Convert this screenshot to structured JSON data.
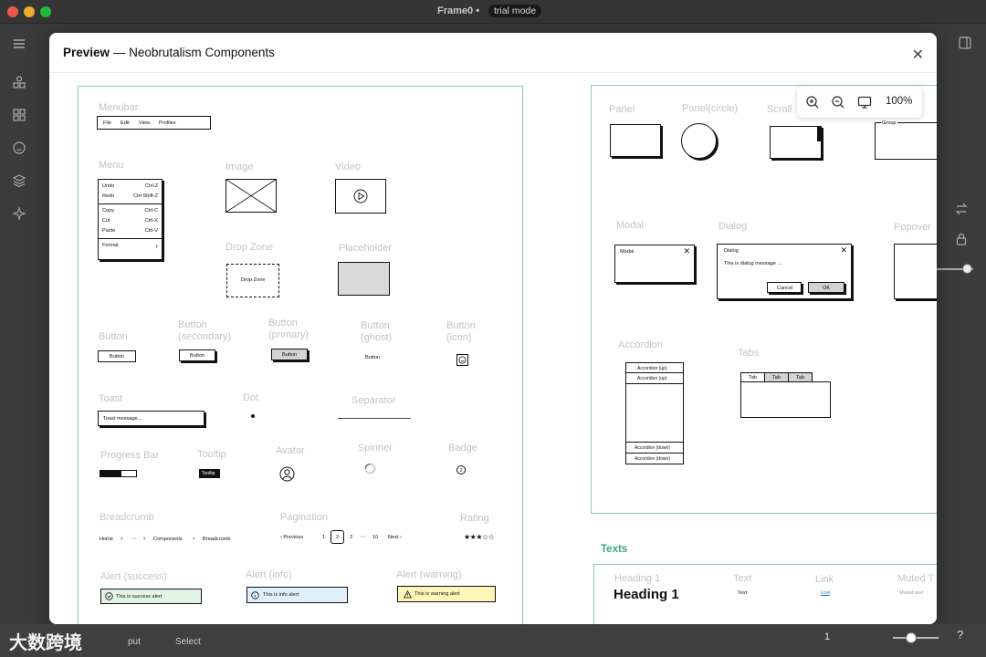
{
  "window": {
    "title": "Frame0 •",
    "badge": "trial mode"
  },
  "modal": {
    "title_bold": "Preview",
    "title_dash": "—",
    "title_rest": "Neobrutalism Components"
  },
  "zoom": {
    "value": "100%"
  },
  "sections": {
    "texts": "Texts"
  },
  "components": {
    "menubar_label": "Menubar",
    "menubar_items": [
      "File",
      "Edit",
      "View",
      "Profiles"
    ],
    "menu_label": "Menu",
    "menu_rows": [
      {
        "label": "Undo",
        "shortcut": "Ctrl-Z"
      },
      {
        "label": "Redo",
        "shortcut": "Ctrl-Shift-Z"
      },
      {
        "label": "Copy",
        "shortcut": "Ctrl-C"
      },
      {
        "label": "Cut",
        "shortcut": "Ctrl-X"
      },
      {
        "label": "Paste",
        "shortcut": "Ctrl-V"
      },
      {
        "label": "Format",
        "shortcut": "›"
      }
    ],
    "image_label": "Image",
    "video_label": "Video",
    "dropzone_label": "Drop Zone",
    "dropzone_text": "Drop Zone",
    "placeholder_label": "Placeholder",
    "button_label": "Button",
    "button_secondary_label": "Button (secondary)",
    "button_primary_label": "Button (primary)",
    "button_ghost_label": "Button (ghost)",
    "button_icon_label": "Button (icon)",
    "button_text": "Button",
    "toast_label": "Toast",
    "toast_text": "Toast message...",
    "dot_label": "Dot",
    "separator_label": "Separator",
    "progress_label": "Progress Bar",
    "progress_value": 0.6,
    "tooltip_label": "Tooltip",
    "tooltip_text": "Tooltip",
    "avatar_label": "Avatar",
    "spinner_label": "Spinner",
    "badge_label": "Badge",
    "badge_value": "2",
    "breadcrumb_label": "Breadcrumb",
    "breadcrumb_items": [
      "Home",
      "›",
      "···",
      "›",
      "Components",
      "›",
      "Breadcrumb"
    ],
    "pagination_label": "Pagination",
    "pagination_prev": "‹  Previous",
    "pagination_pages": [
      "1",
      "2",
      "3",
      "···",
      "10"
    ],
    "pagination_next": "Next  ›",
    "rating_label": "Rating",
    "rating_value": "★★★☆☆",
    "alert_success_label": "Alert (success)",
    "alert_success_text": "This is success alert",
    "alert_info_label": "Alert (info)",
    "alert_info_text": "This is info alert",
    "alert_warning_label": "Alert (warning)",
    "alert_warning_text": "This is warning alert"
  },
  "right": {
    "panel_label": "Panel",
    "panel_circle_label": "Panel(circle)",
    "scroll_label": "Scroll",
    "group_text": "Group",
    "modal_label": "Modal",
    "modal_text": "Modal",
    "dialog_label": "Dialog",
    "dialog_title": "Dialog",
    "dialog_message": "This is dialog message ...",
    "dialog_cancel": "Cancel",
    "dialog_ok": "OK",
    "popover_label": "Popover",
    "accordion_label": "Accordion",
    "accordion_items": [
      "Accordion (up)",
      "Accordion (up)",
      "Accordion (down)",
      "Accordion (down)"
    ],
    "tabs_label": "Tabs",
    "tabs": [
      "Tab",
      "Tab",
      "Tab"
    ]
  },
  "texts": {
    "heading_label": "Heading 1",
    "heading_text": "Heading 1",
    "text_label": "Text",
    "text_text": "Text",
    "link_label": "Link",
    "link_text": "Link",
    "muted_label": "Muted T",
    "muted_text": "Muted text"
  },
  "bottom": {
    "output": "put",
    "select": "Select",
    "page_num": "1"
  },
  "watermark": "大数跨境"
}
